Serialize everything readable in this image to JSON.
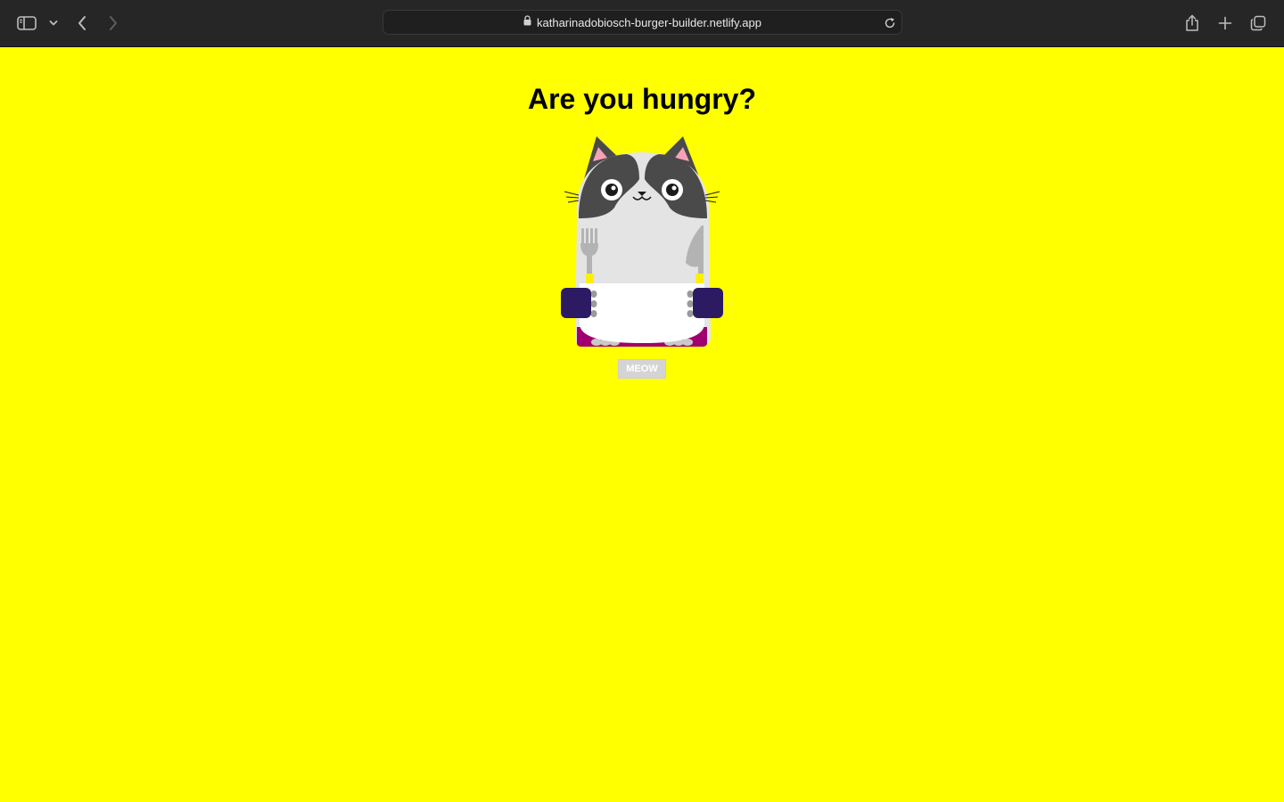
{
  "browser": {
    "url": "katharinadobiosch-burger-builder.netlify.app",
    "icons": {
      "sidebar": "sidebar-icon",
      "chevron": "chevron-down-icon",
      "back": "back-arrow-icon",
      "forward": "forward-arrow-icon",
      "lock": "lock-icon",
      "reload": "reload-icon",
      "share": "share-icon",
      "new_tab": "plus-icon",
      "tabs": "tabs-overview-icon"
    }
  },
  "page": {
    "background": "#ffff00",
    "title": "Are you hungry?",
    "illustration": "cat-with-fork-knife-and-plate",
    "button_label": "MEOW"
  }
}
